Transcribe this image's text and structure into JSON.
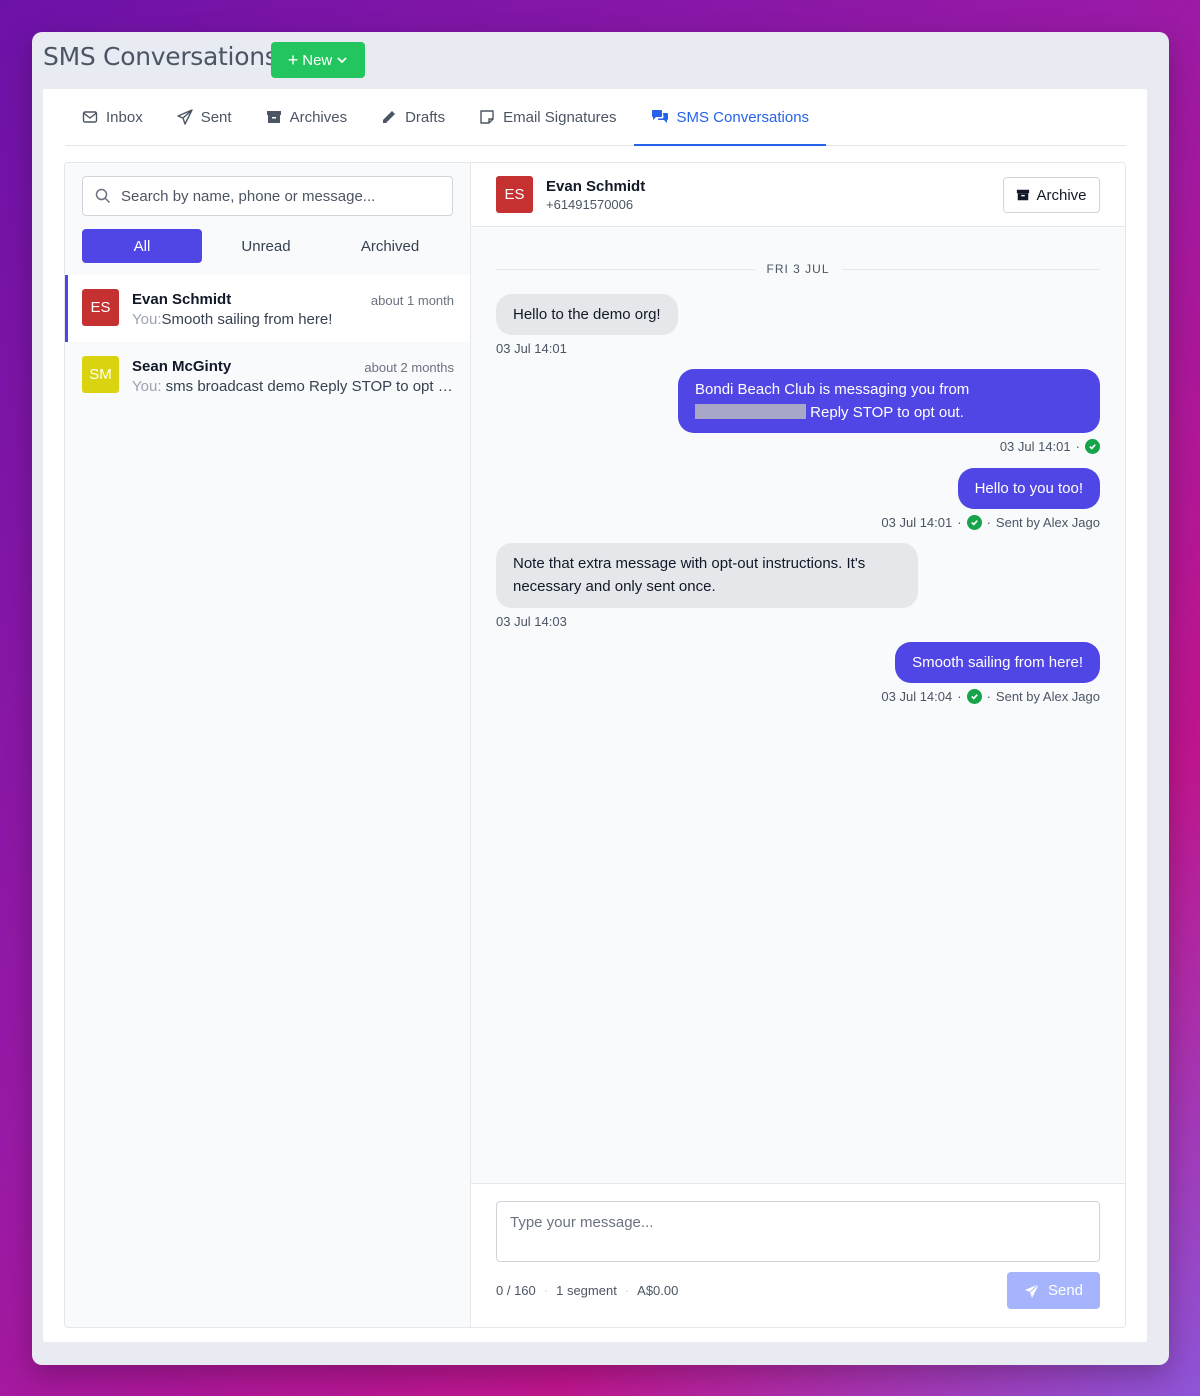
{
  "app": {
    "title": "SMS Conversations",
    "new_label": "New"
  },
  "tabs": [
    {
      "label": "Inbox",
      "icon": "envelope-icon"
    },
    {
      "label": "Sent",
      "icon": "paper-plane-icon"
    },
    {
      "label": "Archives",
      "icon": "archive-icon"
    },
    {
      "label": "Drafts",
      "icon": "pencil-icon"
    },
    {
      "label": "Email Signatures",
      "icon": "note-icon"
    },
    {
      "label": "SMS Conversations",
      "icon": "comments-icon",
      "active": true
    }
  ],
  "sidebar": {
    "search_placeholder": "Search by name, phone or message...",
    "filters": [
      "All",
      "Unread",
      "Archived"
    ],
    "active_filter": "All",
    "conversations": [
      {
        "initials": "ES",
        "name": "Evan Schmidt",
        "time": "about 1 month",
        "you": "You:",
        "preview": "Smooth sailing from here!",
        "color": "#c53030",
        "active": true
      },
      {
        "initials": "SM",
        "name": "Sean McGinty",
        "time": "about 2 months",
        "you": "You:",
        "preview": " sms broadcast demo Reply STOP to opt out.",
        "color": "#d9d40f"
      }
    ]
  },
  "chat": {
    "initials": "ES",
    "name": "Evan Schmidt",
    "phone": "+61491570006",
    "archive_label": "Archive",
    "date_separator": "FRI 3 JUL",
    "messages": [
      {
        "direction": "in",
        "text": "Hello to the demo org!",
        "time": "03 Jul 14:01"
      },
      {
        "direction": "out",
        "line1": "Bondi Beach Club is messaging you from",
        "line2": "Reply STOP to opt out.",
        "time": "03 Jul 14:01",
        "delivered": true
      },
      {
        "direction": "out",
        "text": "Hello to you too!",
        "time": "03 Jul 14:01",
        "delivered": true,
        "sent_by": "Sent by Alex Jago"
      },
      {
        "direction": "in",
        "text": "Note that extra message with opt-out instructions. It's necessary and only sent once.",
        "time": "03 Jul 14:03"
      },
      {
        "direction": "out",
        "text": "Smooth sailing from here!",
        "time": "03 Jul 14:04",
        "delivered": true,
        "sent_by": "Sent by Alex Jago"
      }
    ],
    "separator": "·"
  },
  "composer": {
    "placeholder": "Type your message...",
    "char_count": "0 / 160",
    "segments": "1 segment",
    "cost": "A$0.00",
    "send_label": "Send"
  },
  "colors": {
    "accent": "#4f46e5",
    "tab_active": "#2563eb",
    "new_button": "#22c55e",
    "delivered": "#16a34a"
  }
}
